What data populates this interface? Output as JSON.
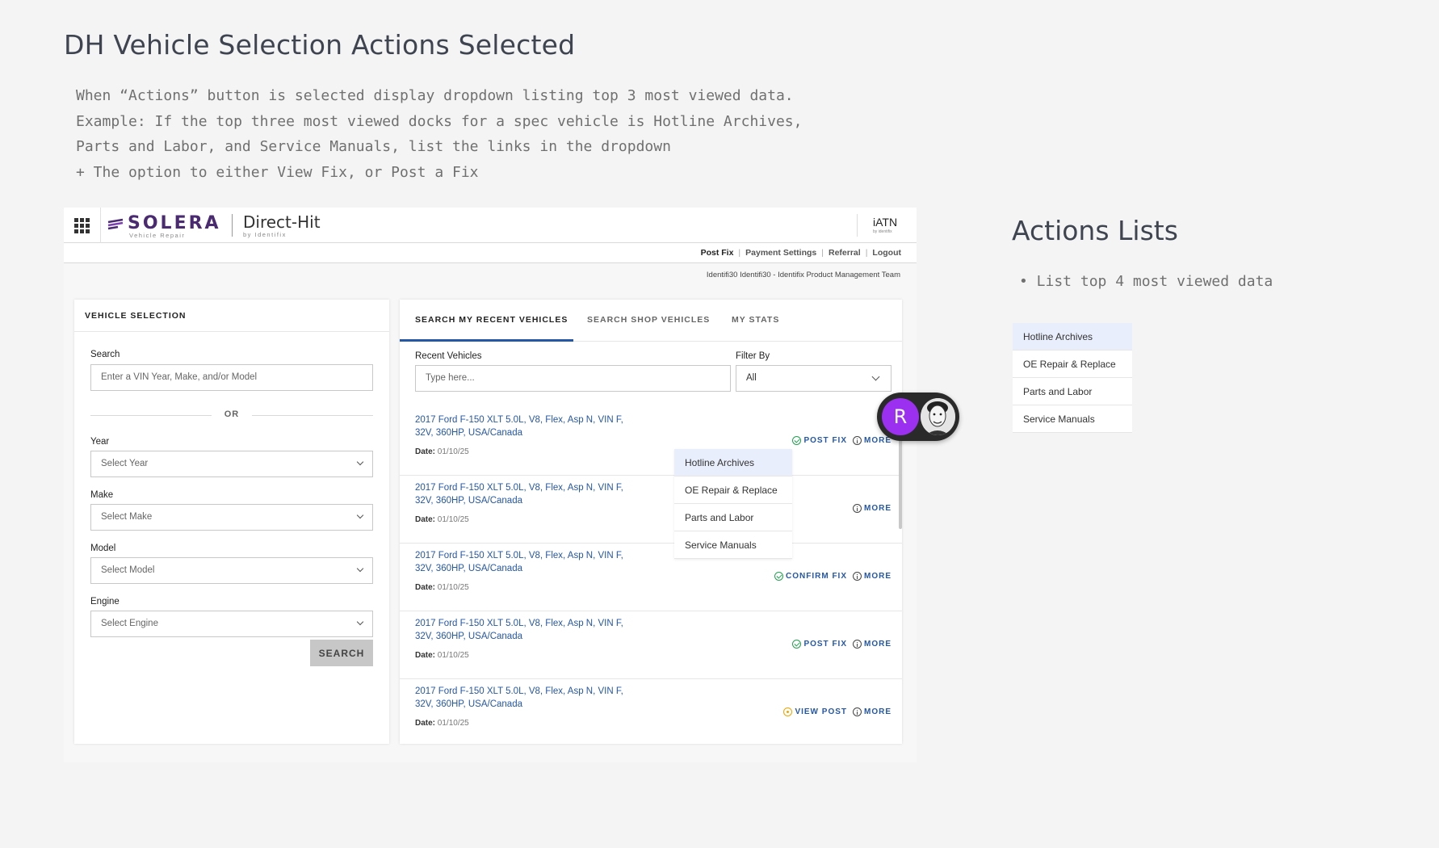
{
  "page": {
    "title": "DH Vehicle Selection Actions Selected",
    "description": "When “Actions” button is selected display dropdown listing top 3 most viewed data.\nExample: If the top three most viewed docks for a spec vehicle is Hotline Archives,\nParts and Labor, and Service Manuals, list the links in the dropdown\n+ The option to either View Fix, or Post a Fix"
  },
  "side": {
    "title": "Actions Lists",
    "bullet": "• List top 4 most viewed data",
    "items": [
      "Hotline Archives",
      "OE Repair & Replace",
      "Parts and Labor",
      "Service Manuals"
    ]
  },
  "app": {
    "logo": "SOLERA",
    "logo_sub": "Vehicle Repair",
    "product": "Direct-Hit",
    "product_sub": "by Identifix",
    "iatn": "iATN",
    "iatn_sub": "by identifix",
    "nav": [
      "Post Fix",
      "Payment Settings",
      "Referral",
      "Logout"
    ],
    "team": "Identifi30 Identifi30 - Identifix Product Management Team"
  },
  "vehicle_selection": {
    "heading": "VEHICLE SELECTION",
    "search_label": "Search",
    "search_placeholder": "Enter a VIN Year, Make, and/or Model",
    "or": "OR",
    "year_label": "Year",
    "year_value": "Select Year",
    "make_label": "Make",
    "make_value": "Select Make",
    "model_label": "Model",
    "model_value": "Select Model",
    "engine_label": "Engine",
    "engine_value": "Select Engine",
    "search_button": "SEARCH"
  },
  "tabs": [
    "SEARCH MY RECENT VEHICLES",
    "SEARCH SHOP VEHICLES",
    "MY STATS"
  ],
  "recent": {
    "label": "Recent Vehicles",
    "placeholder": "Type here...",
    "filter_label": "Filter By",
    "filter_value": "All"
  },
  "vehicles": [
    {
      "title": "2017 Ford F-150 XLT 5.0L, V8, Flex, Asp N, VIN F, 32V, 360HP, USA/Canada",
      "date_label": "Date:",
      "date": "01/10/25",
      "action": "POST FIX",
      "more": "MORE"
    },
    {
      "title": "2017 Ford F-150 XLT 5.0L, V8, Flex, Asp N, VIN F, 32V, 360HP, USA/Canada",
      "date_label": "Date:",
      "date": "01/10/25",
      "action": "",
      "more": "MORE"
    },
    {
      "title": "2017 Ford F-150 XLT 5.0L, V8, Flex, Asp N, VIN F, 32V, 360HP, USA/Canada",
      "date_label": "Date:",
      "date": "01/10/25",
      "action": "CONFIRM FIX",
      "more": "MORE"
    },
    {
      "title": "2017 Ford F-150 XLT 5.0L, V8, Flex, Asp N, VIN F, 32V, 360HP, USA/Canada",
      "date_label": "Date:",
      "date": "01/10/25",
      "action": "POST FIX",
      "more": "MORE"
    },
    {
      "title": "2017 Ford F-150 XLT 5.0L, V8, Flex, Asp N, VIN F, 32V, 360HP, USA/Canada",
      "date_label": "Date:",
      "date": "01/10/25",
      "action": "VIEW POST",
      "more": "MORE"
    }
  ],
  "dropdown": [
    "Hotline Archives",
    "OE Repair & Replace",
    "Parts and Labor",
    "Service Manuals"
  ],
  "avatar": {
    "initial": "R",
    "color": "#9b30f0"
  },
  "colors": {
    "link": "#2557a7",
    "success": "#22a04f",
    "warning": "#f0a500",
    "brand": "#4a2a70"
  }
}
